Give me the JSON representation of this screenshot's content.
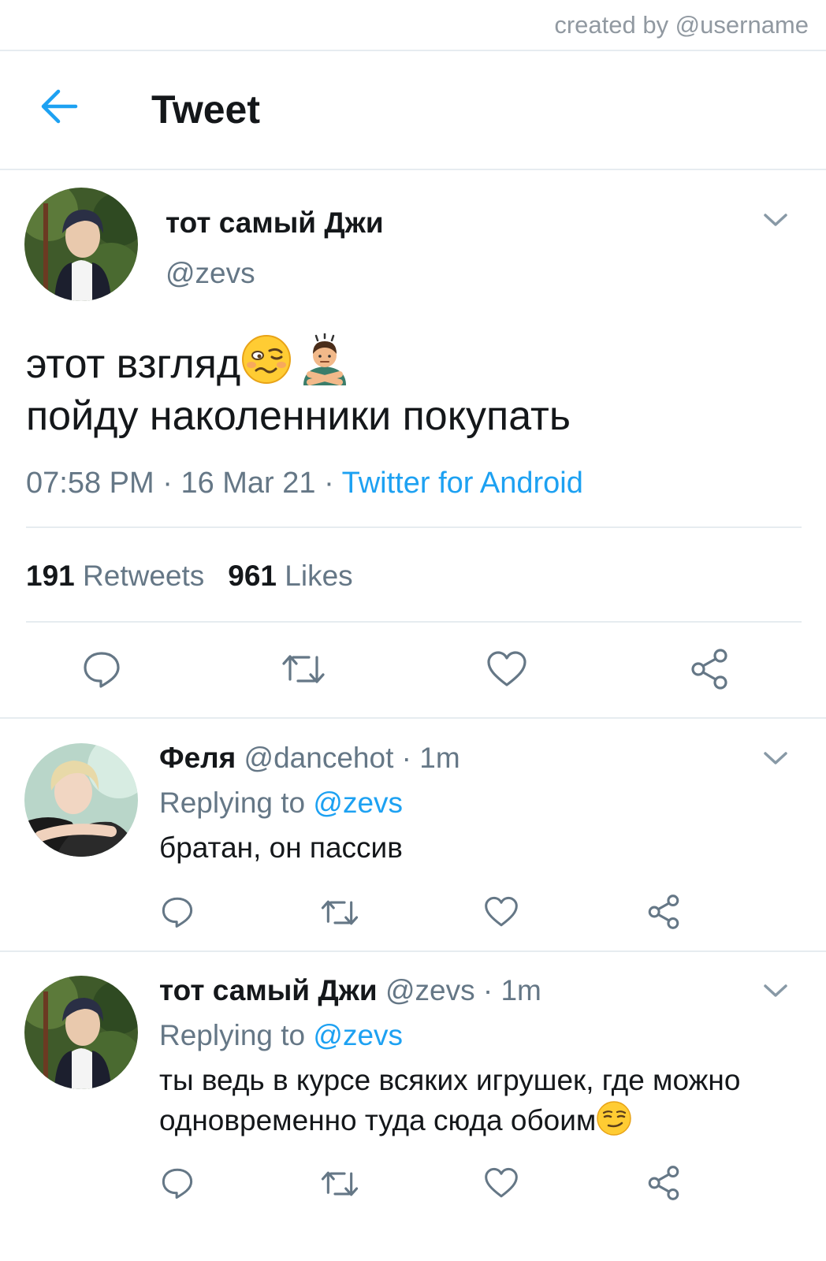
{
  "credit": "created by @username",
  "header": {
    "title": "Tweet"
  },
  "main_tweet": {
    "name": "тот самый Джи",
    "handle": "@zevs",
    "text_line1": "этот взгляд",
    "text_line2": "пойду наколенники покупать",
    "time": "07:58 PM",
    "date": "16 Mar 21",
    "separator": " · ",
    "source": "Twitter for Android",
    "retweets_count": "191",
    "retweets_label": "Retweets",
    "likes_count": "961",
    "likes_label": "Likes"
  },
  "replies": [
    {
      "name": "Феля",
      "handle": "@dancehot",
      "time": "1m",
      "replying_prefix": "Replying to",
      "replying_to": "@zevs",
      "text_line1": "братан, он пассив",
      "text_line2": ""
    },
    {
      "name": "тот самый Джи",
      "handle": "@zevs",
      "time": "1m",
      "replying_prefix": "Replying to",
      "replying_to": "@zevs",
      "text_line1": "ты ведь в курсе всяких игрушек, где можно",
      "text_line2": "одновременно туда сюда обоим"
    }
  ],
  "icons": {
    "back": "arrow-left-icon",
    "caret": "chevron-down-icon",
    "reply": "speech-bubble-icon",
    "retweet": "retweet-icon",
    "like": "heart-icon",
    "share": "share-icon",
    "emoji_1": "woozy-face-emoji",
    "emoji_2": "person-gesturing-no-emoji",
    "emoji_3": "smirking-face-emoji"
  },
  "colors": {
    "accent": "#1da1f2",
    "secondary_text": "#657786",
    "divider": "#e6ecf0"
  }
}
